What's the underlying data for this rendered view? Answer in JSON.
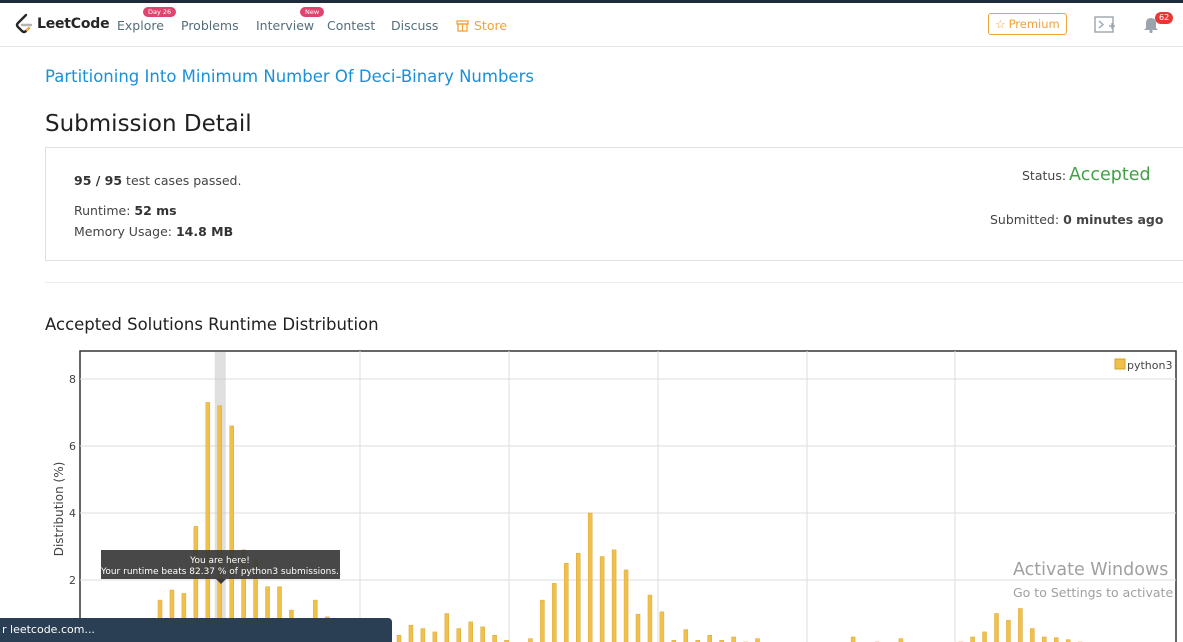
{
  "brand": {
    "name": "LeetCode",
    "accent": "#f0a33a"
  },
  "nav": {
    "explore": "Explore",
    "explore_badge": "Day 26",
    "problems": "Problems",
    "interview": "Interview",
    "interview_badge": "New",
    "contest": "Contest",
    "discuss": "Discuss",
    "store": "Store",
    "premium": "Premium",
    "notifications": "62"
  },
  "problem_title": "Partitioning Into Minimum Number Of Deci-Binary Numbers",
  "page_title": "Submission Detail",
  "submission": {
    "tests": "95 / 95",
    "tests_suffix": "test cases passed.",
    "runtime_label": "Runtime:",
    "runtime": "52 ms",
    "memory_label": "Memory Usage:",
    "memory": "14.8 MB",
    "status_label": "Status:",
    "status": "Accepted",
    "submitted_label": "Submitted:",
    "submitted": "0 minutes ago"
  },
  "section_title": "Accepted Solutions Runtime Distribution",
  "chart_data": {
    "type": "bar",
    "ylabel": "Distribution (%)",
    "yticks": [
      "2",
      "4",
      "6",
      "8"
    ],
    "ylim": [
      0,
      9.1
    ],
    "grid": true,
    "legend": "top-right",
    "series": [
      {
        "name": "python3",
        "color": "#f0c04a",
        "values": [
          1.4,
          1.7,
          1.6,
          3.6,
          7.3,
          7.2,
          6.6,
          2.9,
          2.6,
          1.8,
          1.8,
          1.1,
          0.6,
          1.4,
          0.9,
          0.1,
          0.8,
          0.1,
          0.05,
          0.15,
          0.35,
          0.65,
          0.55,
          0.45,
          1.0,
          0.55,
          0.75,
          0.6,
          0.35,
          0.2,
          0.12,
          0.25,
          1.4,
          1.9,
          2.5,
          2.8,
          4.0,
          2.7,
          2.9,
          2.3,
          0.98,
          1.55,
          1.05,
          0.2,
          0.52,
          0.2,
          0.35,
          0.2,
          0.3,
          0.15,
          0.25,
          0.12,
          0.12,
          0.12,
          0.06,
          0.05,
          0.06,
          0.05,
          0.3,
          0.1,
          0.15,
          0.05,
          0.25,
          0.06,
          0.1,
          0.1,
          0.05,
          0.15,
          0.3,
          0.45,
          1.0,
          0.8,
          1.15,
          0.55,
          0.3,
          0.28,
          0.22,
          0.15
        ]
      }
    ],
    "highlight_index": 5,
    "tooltip": {
      "line1": "You are here!",
      "line2": "Your runtime beats 82.37 % of python3 submissions."
    }
  },
  "status_bar_url": "r leetcode.com...",
  "watermark": {
    "line1": "Activate Windows",
    "line2": "Go to Settings to activate"
  }
}
